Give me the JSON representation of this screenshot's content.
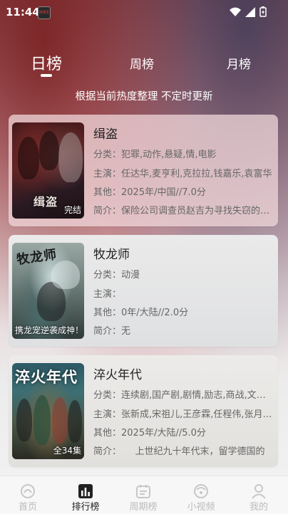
{
  "status_bar": {
    "time": "11:44",
    "app_badge": "NIKE"
  },
  "tabs": [
    {
      "label": "日榜",
      "active": true
    },
    {
      "label": "周榜",
      "active": false
    },
    {
      "label": "月榜",
      "active": false
    }
  ],
  "subtitle": "根据当前热度整理 不定时更新",
  "items": [
    {
      "title": "缉盗",
      "poster_title": "缉盗",
      "poster_tag": "完结",
      "genre_label": "分类：",
      "genre": "犯罪,动作,悬疑,情,电影",
      "cast_label": "主演：",
      "cast": "任达华,麦亨利,克拉拉,钱嘉乐,袁富华",
      "other_label": "其他：",
      "other": "2025年/中国//7.0分",
      "summary_label": "简介：",
      "summary": "保险公司调查员赵吉为寻找失窃的古董"
    },
    {
      "title": "牧龙师",
      "poster_title": "牧龙师",
      "poster_tag": "携龙宠逆袭成神！",
      "genre_label": "分类：",
      "genre": "动漫",
      "cast_label": "主演：",
      "cast": "",
      "other_label": "其他：",
      "other": "0年/大陆//2.0分",
      "summary_label": "简介：",
      "summary": "无"
    },
    {
      "title": "淬火年代",
      "poster_title": "淬火年代",
      "poster_tag": "全34集",
      "genre_label": "分类：",
      "genre": "连续剧,国产剧,剧情,励志,商战,文学改编",
      "cast_label": "主演：",
      "cast": "张新成,宋祖儿,王彦霖,任程伟,张月,李乃文",
      "other_label": "其他：",
      "other": "2025年/大陆//5.0分",
      "summary_label": "简介：",
      "summary": "　　上世纪九十年代末，留学德国的"
    }
  ],
  "nav": [
    {
      "label": "首页",
      "icon": "home-icon",
      "active": false
    },
    {
      "label": "排行榜",
      "icon": "ranking-icon",
      "active": true
    },
    {
      "label": "周期榜",
      "icon": "calendar-icon",
      "active": false
    },
    {
      "label": "小视频",
      "icon": "short-video-icon",
      "active": false
    },
    {
      "label": "我的",
      "icon": "profile-icon",
      "active": false
    }
  ]
}
